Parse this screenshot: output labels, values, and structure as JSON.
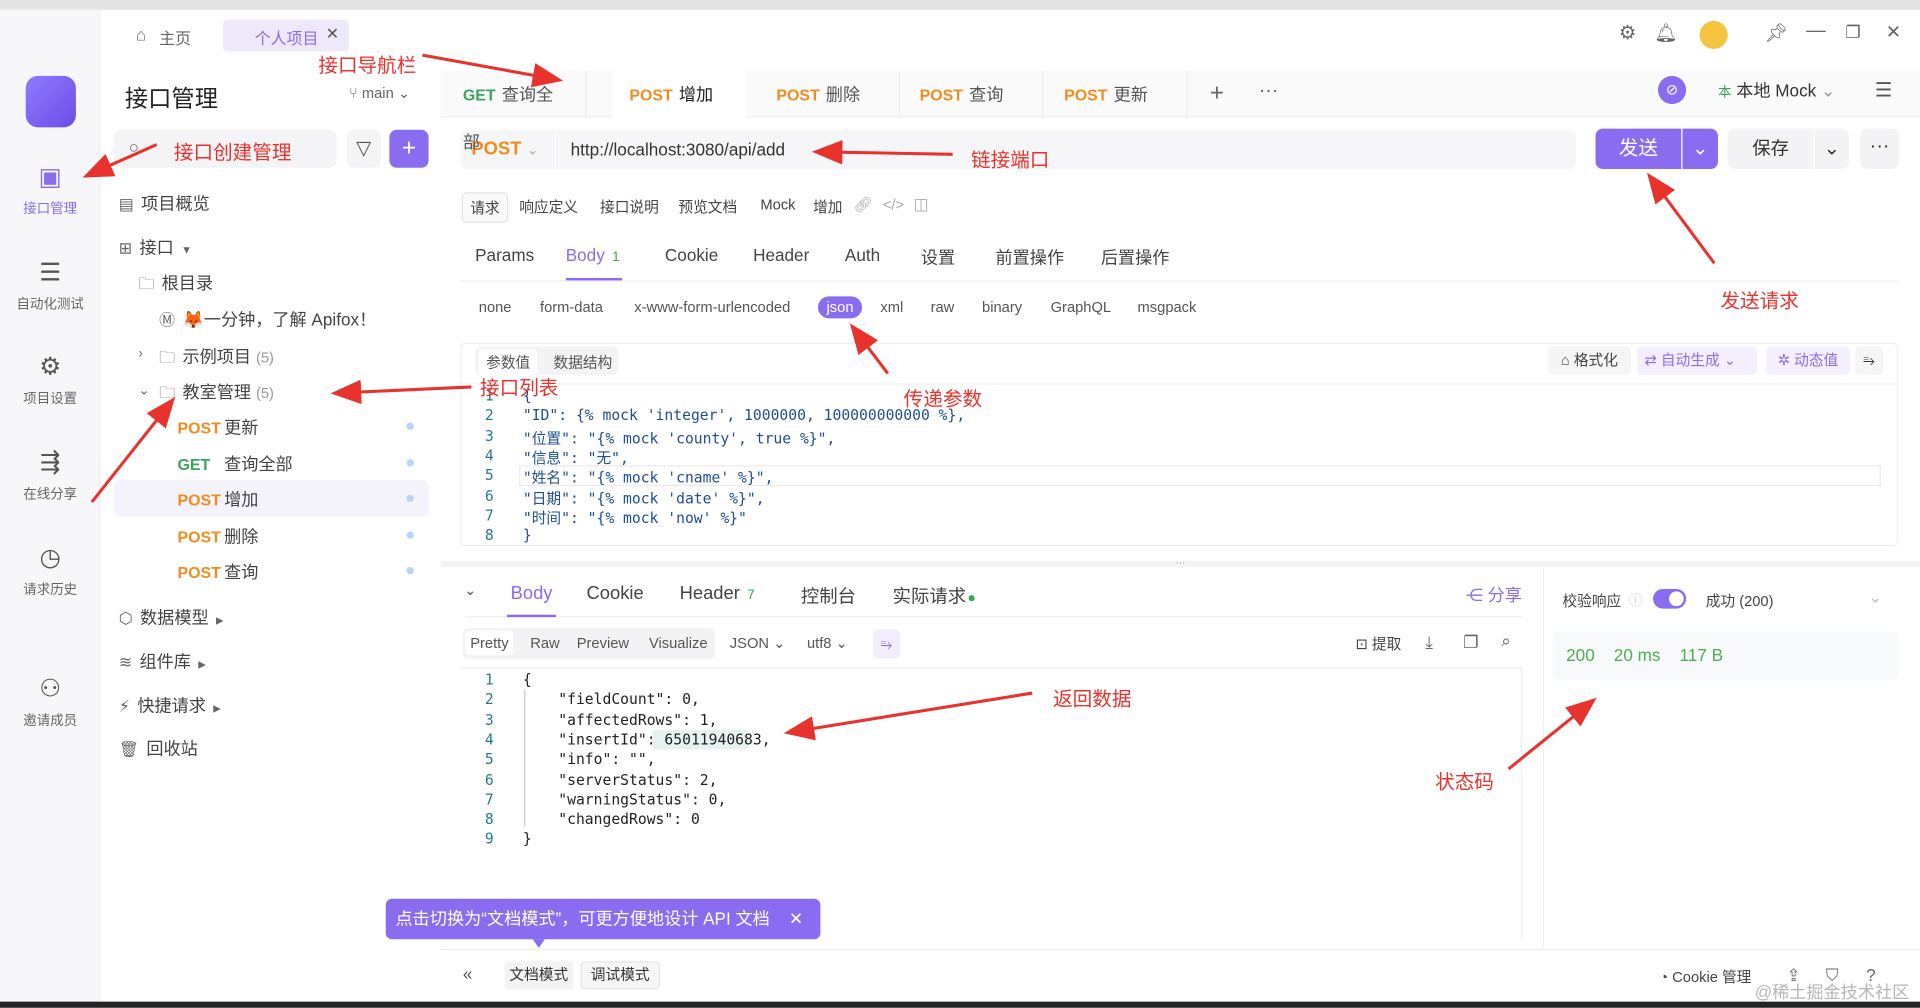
{
  "window": {
    "home_tab": "主页",
    "project_tab": "个人项目"
  },
  "rail": {
    "items": [
      {
        "label": "接口管理",
        "icon": "api-icon",
        "active": true
      },
      {
        "label": "自动化测试",
        "icon": "automation-icon"
      },
      {
        "label": "项目设置",
        "icon": "settings-icon"
      },
      {
        "label": "在线分享",
        "icon": "share-icon"
      },
      {
        "label": "请求历史",
        "icon": "history-icon"
      },
      {
        "label": "邀请成员",
        "icon": "invite-user-icon"
      }
    ]
  },
  "sidebar": {
    "title": "接口管理",
    "branch": "main",
    "overview": "项目概览",
    "api_group": "接口",
    "root": "根目录",
    "intro": "🦊一分钟，了解 Apifox！",
    "folders": [
      {
        "name": "示例项目",
        "count": "(5)"
      },
      {
        "name": "教室管理",
        "count": "(5)"
      }
    ],
    "endpoints": [
      {
        "method": "POST",
        "name": "更新"
      },
      {
        "method": "GET",
        "name": "查询全部"
      },
      {
        "method": "POST",
        "name": "增加",
        "active": true
      },
      {
        "method": "POST",
        "name": "删除"
      },
      {
        "method": "POST",
        "name": "查询"
      }
    ],
    "sections": [
      "数据模型",
      "组件库",
      "快捷请求",
      "回收站"
    ]
  },
  "tabs": [
    {
      "method": "GET",
      "name": "查询全部"
    },
    {
      "method": "POST",
      "name": "增加",
      "active": true
    },
    {
      "method": "POST",
      "name": "删除"
    },
    {
      "method": "POST",
      "name": "查询"
    },
    {
      "method": "POST",
      "name": "更新"
    }
  ],
  "env": {
    "prefix": "本",
    "label": "本地 Mock"
  },
  "request": {
    "method": "POST",
    "url": "http://localhost:3080/api/add",
    "send": "发送",
    "save": "保存",
    "subtabs": [
      "请求",
      "响应定义",
      "接口说明",
      "预览文档",
      "Mock",
      "增加"
    ],
    "param_tabs": [
      "Params",
      "Body",
      "Cookie",
      "Header",
      "Auth",
      "设置",
      "前置操作",
      "后置操作"
    ],
    "body_count": "1",
    "body_types": [
      "none",
      "form-data",
      "x-www-form-urlencoded",
      "json",
      "xml",
      "raw",
      "binary",
      "GraphQL",
      "msgpack"
    ],
    "editor_modes": [
      "参数值",
      "数据结构"
    ],
    "tools": {
      "format": "格式化",
      "auto": "自动生成",
      "dynamic": "动态值"
    },
    "code": [
      "{",
      "\"ID\": {% mock 'integer', 1000000, 100000000000 %},",
      "\"位置\": \"{% mock 'county', true %}\",",
      "\"信息\": \"无\",",
      "\"姓名\": \"{% mock 'cname' %}\",",
      "\"日期\": \"{% mock 'date' %}\",",
      "\"时间\": \"{% mock 'now' %}\"",
      "}"
    ]
  },
  "response": {
    "tabs": [
      "Body",
      "Cookie",
      "Header",
      "控制台",
      "实际请求"
    ],
    "header_count": "7",
    "share": "分享",
    "views": [
      "Pretty",
      "Raw",
      "Preview",
      "Visualize"
    ],
    "format": "JSON",
    "encoding": "utf8",
    "extract": "提取",
    "code": [
      "{",
      "    \"fieldCount\": 0,",
      "    \"affectedRows\": 1,",
      "    \"insertId\": 65011940683,",
      "    \"info\": \"\",",
      "    \"serverStatus\": 2,",
      "    \"warningStatus\": 0,",
      "    \"changedRows\": 0",
      "}"
    ],
    "validate": "校验响应",
    "validate_on": true,
    "result": "成功 (200)",
    "status": "200",
    "time": "20 ms",
    "size": "117 B"
  },
  "tooltip": "点击切换为“文档模式”，可更方便地设计 API 文档",
  "footer": {
    "doc_mode": "文档模式",
    "debug_mode": "调试模式",
    "cookie": "Cookie 管理",
    "watermark": "@稀土掘金技术社区"
  },
  "annotations": [
    "接口导航栏",
    "接口创建管理",
    "链接端口",
    "发送请求",
    "传递参数",
    "接口列表",
    "返回数据",
    "状态码"
  ],
  "colors": {
    "accent": "#8a6cf0",
    "get": "#3aa55a",
    "post": "#f08c1e",
    "annotation": "#e8322e",
    "status": "#4caf50"
  }
}
